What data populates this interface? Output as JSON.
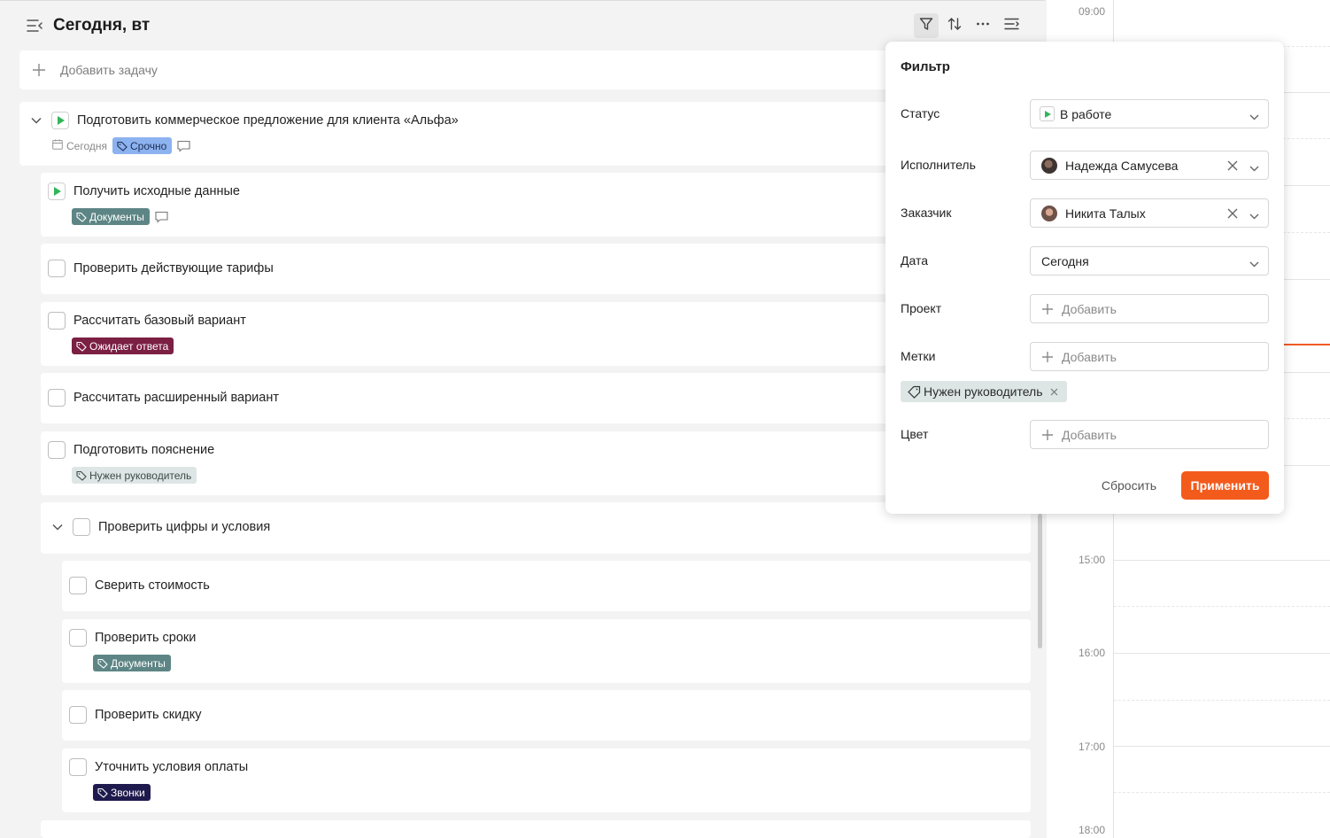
{
  "header": {
    "title": "Сегодня, вт",
    "icons": [
      "collapse-menu-icon",
      "filter-icon",
      "sort-icon",
      "more-icon",
      "list-settings-icon"
    ]
  },
  "add_task": {
    "label": "Добавить задачу"
  },
  "tasks": [
    {
      "title": "Подготовить коммерческое предложение для клиента «Альфа»",
      "status": "in-progress",
      "date": "Сегодня",
      "tag": "Срочно"
    },
    {
      "title": "Получить исходные данные",
      "status": "in-progress",
      "tag": "Документы"
    },
    {
      "title": "Проверить действующие тарифы"
    },
    {
      "title": "Рассчитать базовый вариант",
      "tag": "Ожидает ответа"
    },
    {
      "title": "Рассчитать расширенный вариант"
    },
    {
      "title": "Подготовить пояснение",
      "tag": "Нужен руководитель"
    },
    {
      "title": "Проверить цифры и условия"
    },
    {
      "title": "Сверить стоимость"
    },
    {
      "title": "Проверить сроки",
      "tag": "Документы"
    },
    {
      "title": "Проверить скидку"
    },
    {
      "title": "Уточнить условия оплаты",
      "tag": "Звонки"
    }
  ],
  "calendar": {
    "hours": [
      "09:00",
      "15:00",
      "16:00",
      "17:00",
      "18:00"
    ],
    "now_color": "#f15a24"
  },
  "filter": {
    "title": "Фильтр",
    "status_label": "Статус",
    "status_value": "В работе",
    "assignee_label": "Исполнитель",
    "assignee_value": "Надежда Самусева",
    "customer_label": "Заказчик",
    "customer_value": "Никита Талых",
    "date_label": "Дата",
    "date_value": "Сегодня",
    "project_label": "Проект",
    "project_placeholder": "Добавить",
    "labels_label": "Метки",
    "labels_placeholder": "Добавить",
    "selected_label": "Нужен руководитель",
    "color_label": "Цвет",
    "color_placeholder": "Добавить",
    "reset": "Сбросить",
    "apply": "Применить",
    "apply_color": "#f35b1c"
  }
}
